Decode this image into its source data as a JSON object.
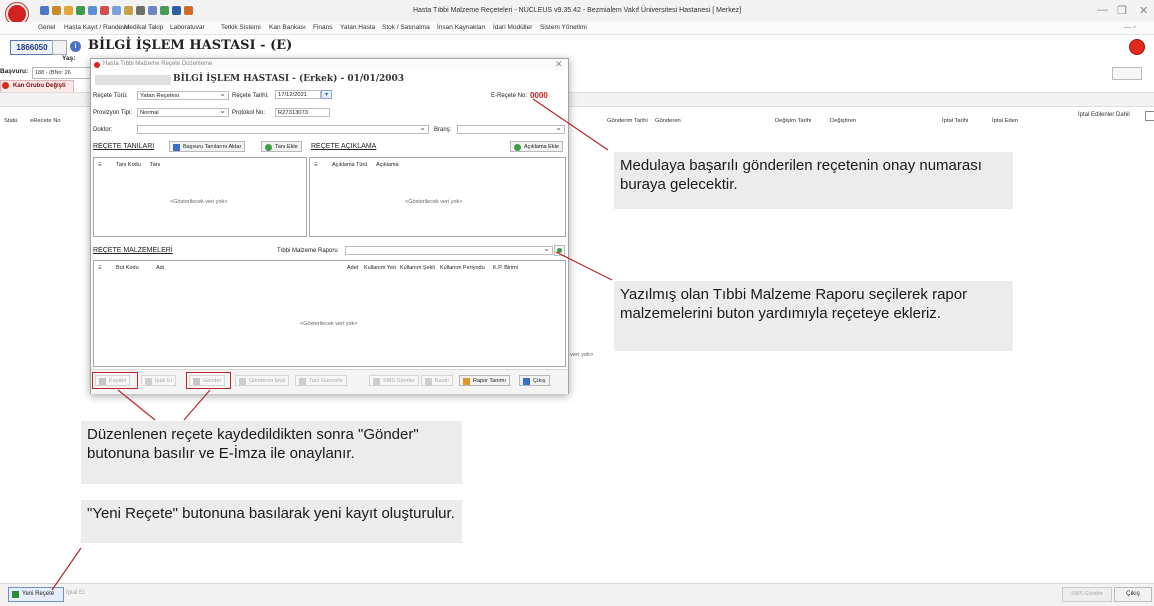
{
  "window": {
    "title": "Hasta Tıbbi Malzeme Reçeteleri - NUCLEUS v9.35.42 - Bezmialem Vakıf Üniversitesi Hastanesi [ Merkez]",
    "min_glyph": "—",
    "restore_glyph": "❐",
    "close_glyph": "✕"
  },
  "menu": [
    "Genel",
    "Hasta Kayıt / Randevu",
    "Medikal Takip",
    "Laboratuvar",
    "Tetkik Sistemi",
    "Kan Bankası",
    "Finans",
    "Yatan Hasta",
    "Stok / Satınalma",
    "İnsan Kaynakları",
    "İdari Modüller",
    "Sistem Yönetimi"
  ],
  "patient": {
    "id": "1866050",
    "name": "BİLGİ İŞLEM HASTASI - (E)",
    "yas_label": "Yaş:",
    "basvuru_label": "Başvuru:",
    "basvuru_value": "188 - (BNo: 26"
  },
  "kan_button": "Kan Grubu Değişti",
  "list_options": {
    "iptal_dahil": "İptal Edilenler Dahil"
  },
  "list_columns": [
    "Statü",
    "eRecete No",
    "Gönderim Tarihi",
    "Gönderen",
    "Değişim Tarihi",
    "Değiştiren",
    "İptal Tarihi",
    "İptal Eden"
  ],
  "bg_empty_fragment": "veri yok>",
  "bottom": {
    "new": "Yeni Reçete",
    "cancel": "İptal Et",
    "sms": "SMS Gönder",
    "exit": "Çıkış"
  },
  "dialog": {
    "title": "Hasta Tıbbi Malzeme Reçete Düzenleme",
    "heading": "BİLGİ İŞLEM HASTASI - (Erkek) - 01/01/2003",
    "recete_turu_label": "Reçete Türü:",
    "recete_turu": "Yatan Reçetesi",
    "recete_tarihi_label": "Reçete Tarihi:",
    "recete_tarihi": "17/12/2021",
    "erecete_label": "E-Reçete No:",
    "erecete_no": "0000",
    "provizyon_label": "Provizyon Tipi:",
    "provizyon": "Normal",
    "protokol_label": "Protokol No:",
    "protokol_no": "R27313073",
    "doktor_label": "Doktor:",
    "brans_label": "Branş:",
    "tanilar_title": "REÇETE TANILARI",
    "btn_basvuru_aktar": "Başvuru Tanılarını Aktar",
    "btn_tani_ekle": "Tanı Ekle",
    "aciklama_title": "REÇETE AÇIKLAMA",
    "btn_aciklama_ekle": "Açıklama Ekle",
    "tani_columns": [
      "Tanı Kodu",
      "Tanı"
    ],
    "aciklama_columns": [
      "Açıklama Türü",
      "Açıklama"
    ],
    "malzemeler_title": "REÇETE MALZEMELERİ",
    "rapor_label": "Tıbbi Malzeme Raporu",
    "malzeme_columns": [
      "But Kodu",
      "Adı",
      "Adet",
      "Kullanım Yeri",
      "Kullanım Şekli",
      "Kullanım Periyodu",
      "K.P. Birimi"
    ],
    "empty_text": "<Gösterilecek veri yok>",
    "toolbar": [
      "Kaydet",
      "İptal Et",
      "Gönder",
      "Gönderim İptal",
      "Tanı Güncelle",
      "SMS Gönder",
      "Bastır",
      "Rapor Tanımı",
      "Çıkış"
    ]
  },
  "callouts": {
    "medula": "Medulaya başarılı gönderilen reçetenin onay numarası buraya gelecektir.",
    "rapor": "Yazılmış olan Tıbbi Malzeme Raporu seçilerek rapor malzemelerini buton yardımıyla reçeteye ekleriz.",
    "gonder": "Düzenlenen reçete kaydedildikten sonra \"Gönder\" butonuna basılır ve E-İmza ile onaylanır.",
    "yeni": "\"Yeni Reçete\" butonuna basılarak yeni kayıt oluşturulur."
  },
  "colors": {
    "accent_red": "#d31d1d",
    "annotation_red": "#b8272b",
    "callout_bg": "#ececec"
  },
  "icons": [
    "app-logo-icon",
    "search-icon",
    "info-icon",
    "stop-icon",
    "calendar-icon",
    "add-icon",
    "exit-icon"
  ]
}
